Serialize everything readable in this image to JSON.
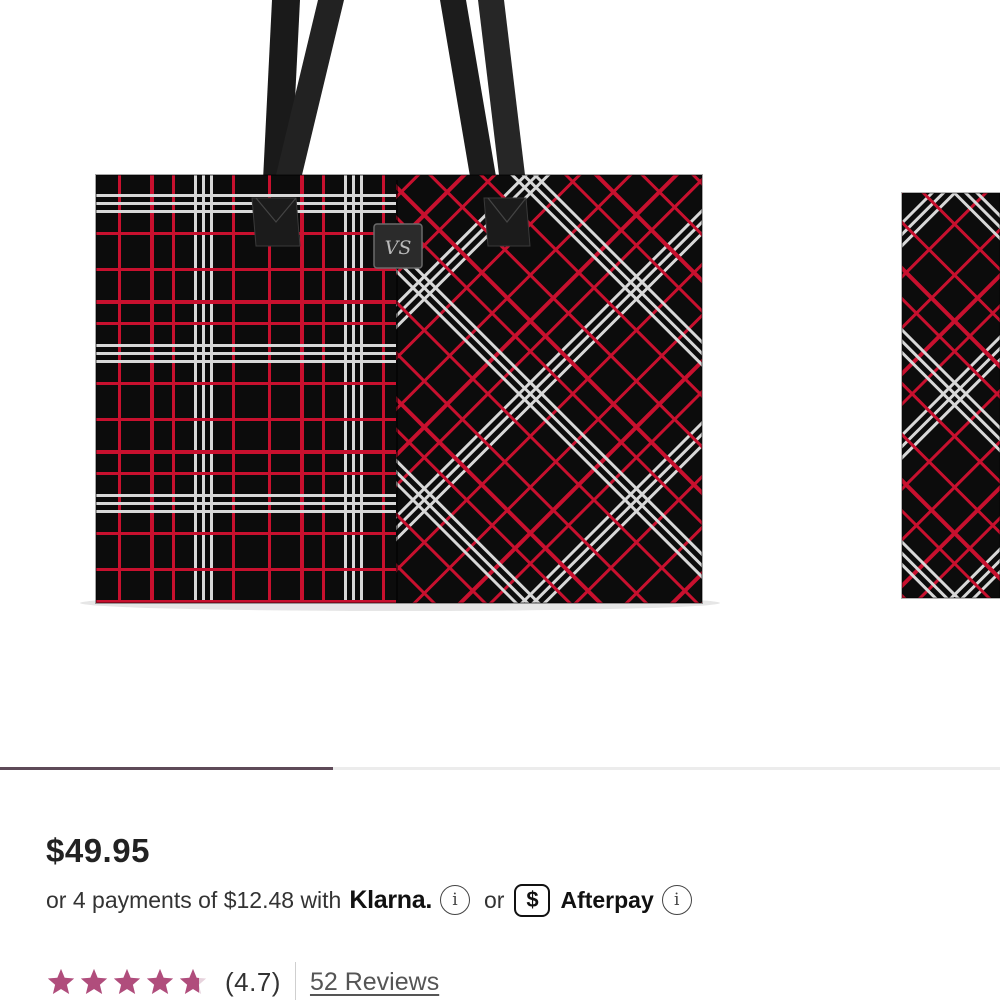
{
  "product": {
    "image_label": "Plaid tote bag",
    "logo_text": "VS"
  },
  "gallery": {
    "progress": 0.333
  },
  "pricing": {
    "price": "$49.95",
    "installment_text": "or 4 payments of $12.48 with",
    "klarna_label": "Klarna.",
    "or_label": "or",
    "afterpay_symbol": "$",
    "afterpay_label": "Afterpay",
    "info_glyph": "i"
  },
  "rating": {
    "stars": 4.7,
    "value_text": "(4.7)",
    "reviews_label": "52 Reviews",
    "star_color": "#b04d7c"
  },
  "colors": {
    "progress": "#5e4a58",
    "plaid_red": "#c8102e"
  },
  "icons": {
    "info": "info-circle-icon",
    "afterpay": "afterpay-dollar-icon",
    "star": "star-icon"
  }
}
